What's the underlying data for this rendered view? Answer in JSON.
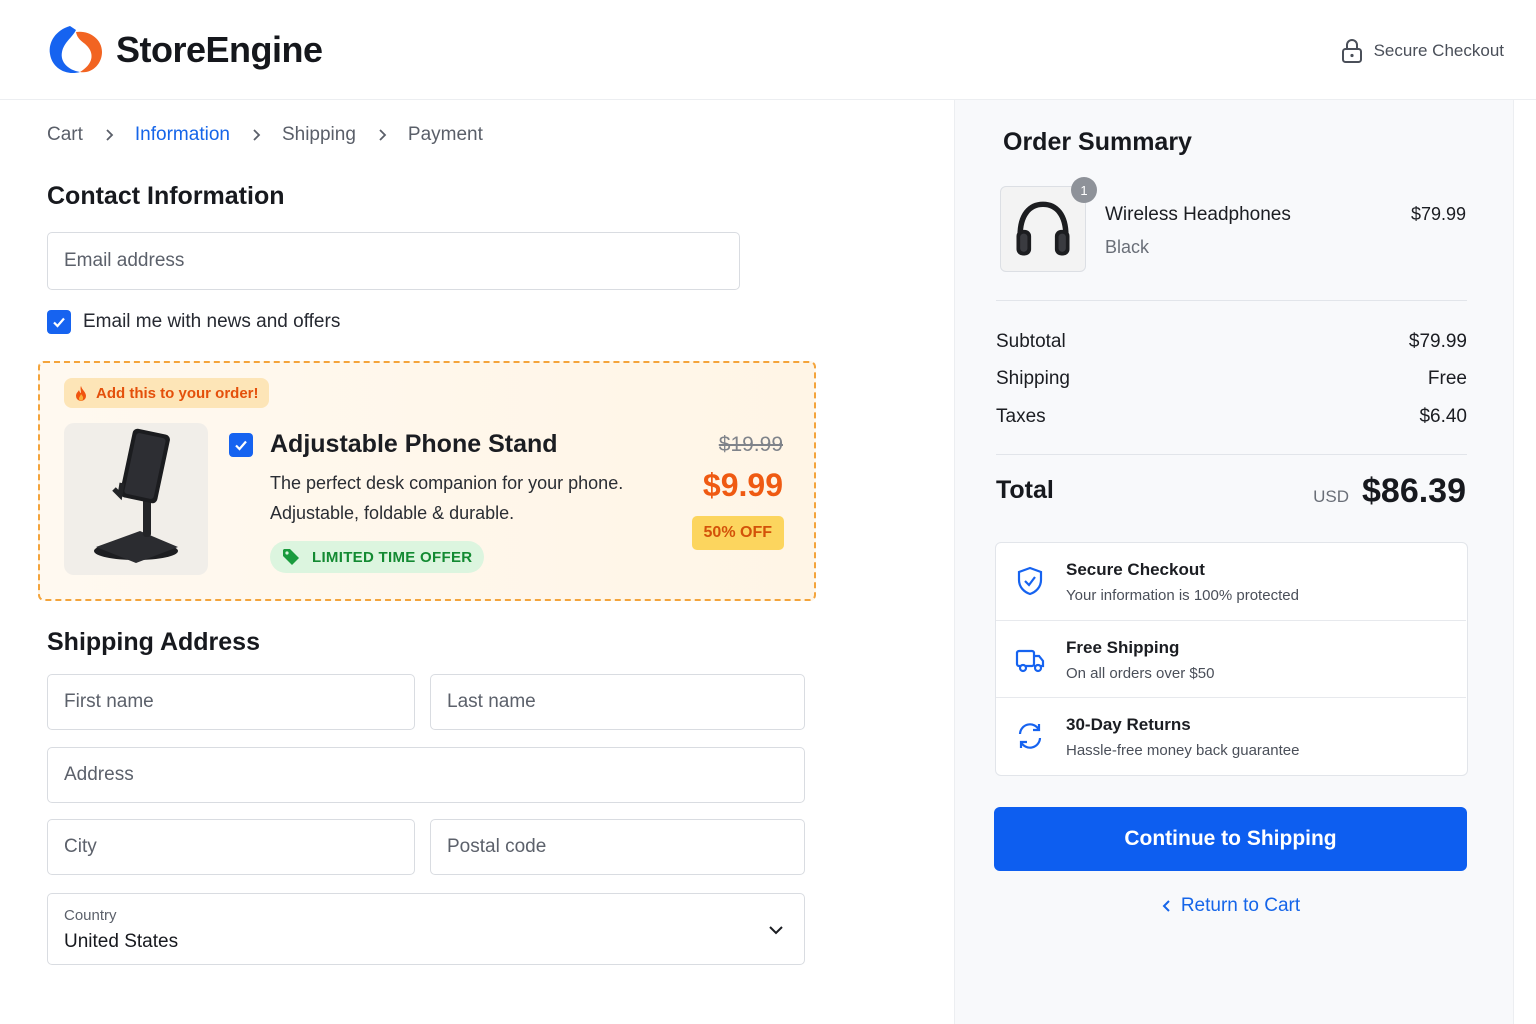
{
  "header": {
    "brand": "StoreEngine",
    "secure_label": "Secure Checkout",
    "accent": "#1663f0",
    "brand_orange": "#f26422"
  },
  "breadcrumb": [
    "Cart",
    "Information",
    "Shipping",
    "Payment"
  ],
  "contact": {
    "title": "Contact Information",
    "email_placeholder": "Email address",
    "newsletter_label": "Email me with news and offers",
    "newsletter_checked": true
  },
  "offer": {
    "badge": "Add this to your order!",
    "title": "Adjustable Phone Stand",
    "description": "The perfect desk companion for your phone. Adjustable, foldable & durable.",
    "tag": "LIMITED TIME OFFER",
    "old_price": "$19.99",
    "new_price": "$9.99",
    "discount": "50% OFF",
    "checked": true
  },
  "shipping": {
    "title": "Shipping Address",
    "first_name_placeholder": "First name",
    "last_name_placeholder": "Last name",
    "address_placeholder": "Address",
    "city_placeholder": "City",
    "postal_placeholder": "Postal code",
    "country_label": "Country",
    "country_value": "United States"
  },
  "summary": {
    "title": "Order Summary",
    "item": {
      "qty": "1",
      "name": "Wireless Headphones",
      "variant": "Black",
      "price": "$79.99"
    },
    "lines": [
      {
        "label": "Subtotal",
        "value": "$79.99"
      },
      {
        "label": "Shipping",
        "value": "Free"
      },
      {
        "label": "Taxes",
        "value": "$6.40"
      }
    ],
    "total_label": "Total",
    "currency": "USD",
    "total": "$86.39",
    "trust": [
      {
        "icon": "shield-check-icon",
        "title": "Secure Checkout",
        "subtitle": "Your information is 100% protected"
      },
      {
        "icon": "truck-icon",
        "title": "Free Shipping",
        "subtitle": "On all orders over $50"
      },
      {
        "icon": "refresh-icon",
        "title": "30-Day Returns",
        "subtitle": "Hassle-free money back guarantee"
      }
    ],
    "cta": "Continue to Shipping",
    "back": "Return to Cart"
  }
}
